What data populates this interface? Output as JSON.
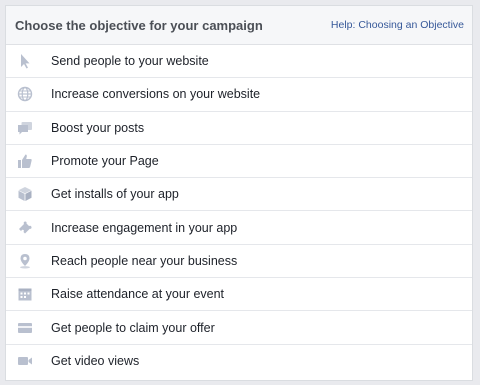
{
  "header": {
    "title": "Choose the objective for your campaign",
    "help_link": "Help: Choosing an Objective"
  },
  "theme": {
    "icon_color": "#b9c0cf",
    "link_color": "#365899",
    "text_color": "#1d2129"
  },
  "objectives": [
    {
      "label": "Send people to your website",
      "icon": "cursor-icon"
    },
    {
      "label": "Increase conversions on your website",
      "icon": "globe-icon"
    },
    {
      "label": "Boost your posts",
      "icon": "posts-icon"
    },
    {
      "label": "Promote your Page",
      "icon": "thumbs-up-icon"
    },
    {
      "label": "Get installs of your app",
      "icon": "box-icon"
    },
    {
      "label": "Increase engagement in your app",
      "icon": "puzzle-icon"
    },
    {
      "label": "Reach people near your business",
      "icon": "map-pin-icon"
    },
    {
      "label": "Raise attendance at your event",
      "icon": "calendar-icon"
    },
    {
      "label": "Get people to claim your offer",
      "icon": "offer-icon"
    },
    {
      "label": "Get video views",
      "icon": "video-camera-icon"
    }
  ]
}
